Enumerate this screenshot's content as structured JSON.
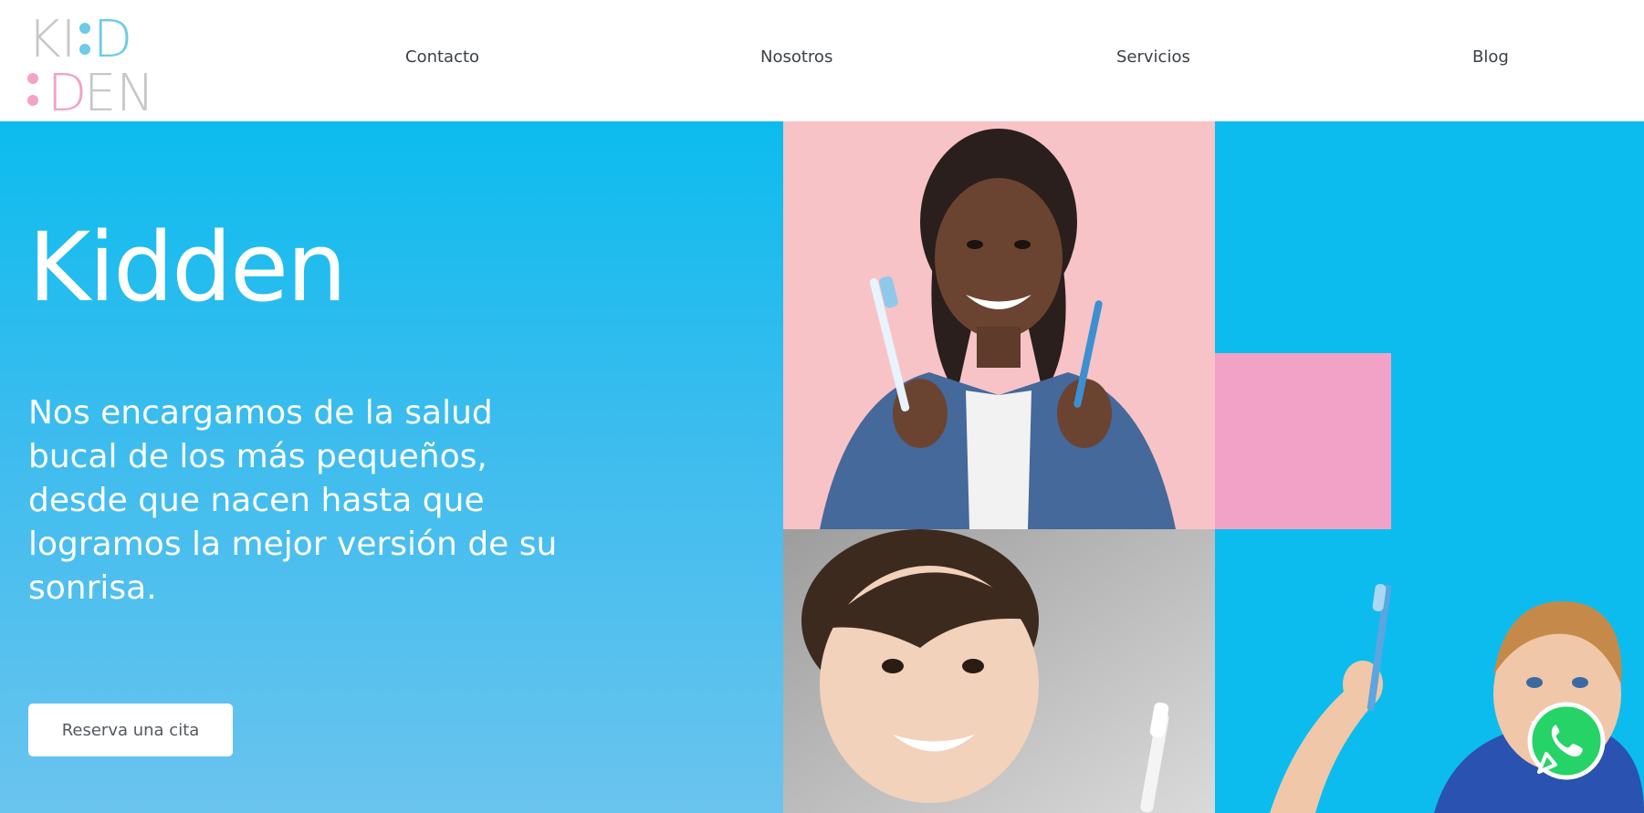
{
  "header": {
    "logo": {
      "line1_left": "KI",
      "line1_dots": ":",
      "line1_right": "D",
      "line2_dots": ":",
      "line2_left": "D",
      "line2_right": "EN"
    },
    "nav": [
      {
        "label": "Contacto"
      },
      {
        "label": "Nosotros"
      },
      {
        "label": "Servicios"
      },
      {
        "label": "Blog"
      }
    ]
  },
  "hero": {
    "title": "Kidden",
    "text": "Nos encargamos de la salud bucal de los más pequeños, desde que nacen hasta que logramos la mejor versión de su sonrisa.",
    "cta_label": "Reserva una cita"
  },
  "colors": {
    "blue": "#0cbcee",
    "pink": "#f6c2c6",
    "accent_pink": "#f2a2c6",
    "logo_blue": "#6ccbe7",
    "logo_pink": "#f2a2c6",
    "logo_gray": "#c7c7c7",
    "whatsapp": "#25d366"
  },
  "icons": {
    "whatsapp": "whatsapp-icon"
  }
}
